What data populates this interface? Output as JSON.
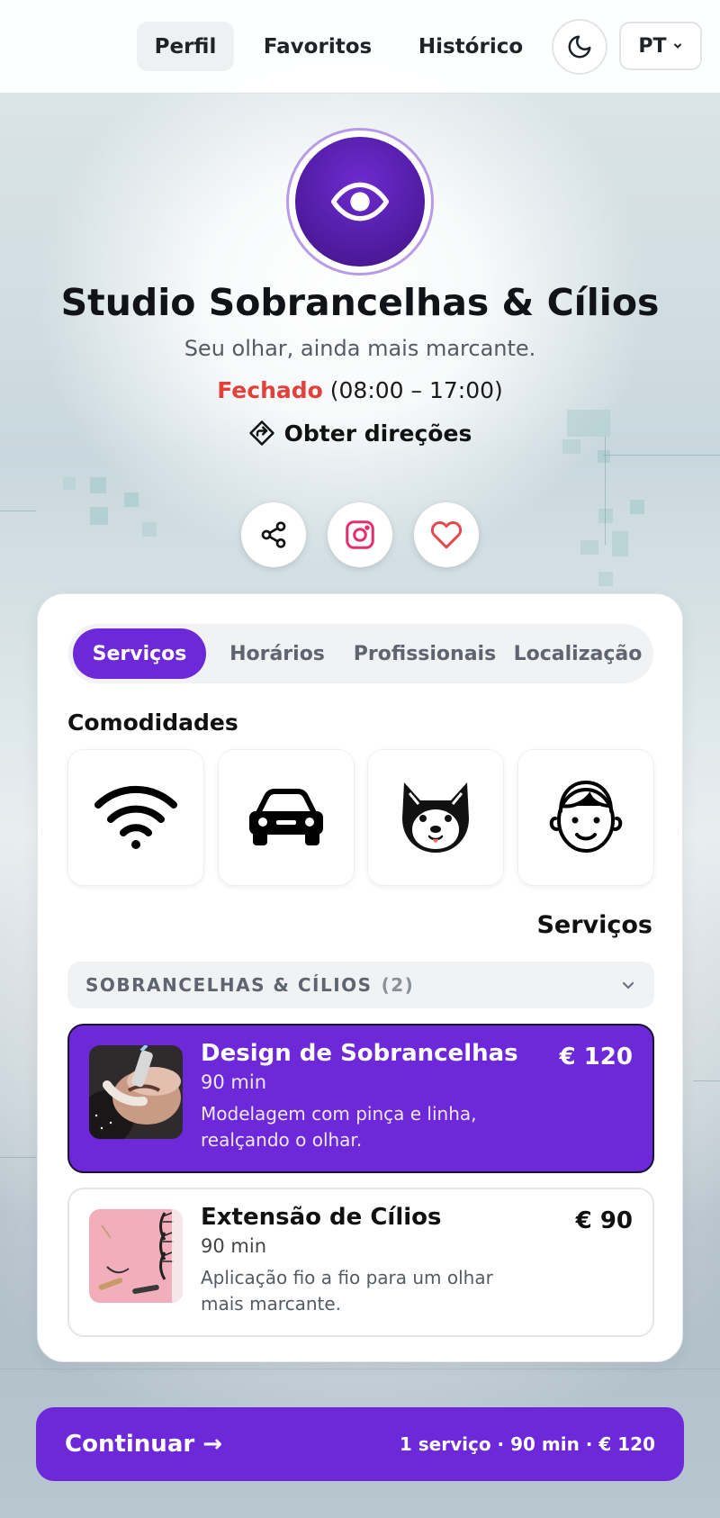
{
  "nav": {
    "items": [
      {
        "label": "Perfil",
        "active": true
      },
      {
        "label": "Favoritos",
        "active": false
      },
      {
        "label": "Histórico",
        "active": false
      }
    ],
    "theme_icon": "moon-icon",
    "language": "PT"
  },
  "business": {
    "logo_icon": "eye-icon",
    "name": "Studio Sobrancelhas & Cílios",
    "tagline": "Seu olhar, ainda mais marcante.",
    "status": "Fechado",
    "hours": "(08:00 – 17:00)",
    "directions_label": "Obter direções"
  },
  "actions": [
    {
      "icon": "share-icon"
    },
    {
      "icon": "instagram-icon"
    },
    {
      "icon": "heart-icon"
    }
  ],
  "tabs": [
    {
      "label": "Serviços",
      "active": true
    },
    {
      "label": "Horários",
      "active": false
    },
    {
      "label": "Profissionais",
      "active": false
    },
    {
      "label": "Localização",
      "active": false
    }
  ],
  "amenities": {
    "title": "Comodidades",
    "items": [
      {
        "icon": "wifi-icon"
      },
      {
        "icon": "car-icon"
      },
      {
        "icon": "dog-icon"
      },
      {
        "icon": "child-icon"
      }
    ]
  },
  "services": {
    "heading": "Serviços",
    "category": {
      "name": "SOBRANCELHAS & CÍLIOS",
      "count": "(2)",
      "expanded": true
    },
    "items": [
      {
        "name": "Design de Sobrancelhas",
        "duration": "90 min",
        "description": "Modelagem com pinça e linha, realçando o olhar.",
        "price": "€ 120",
        "selected": true
      },
      {
        "name": "Extensão de Cílios",
        "duration": "90 min",
        "description": "Aplicação fio a fio para um olhar mais marcante.",
        "price": "€ 90",
        "selected": false
      }
    ]
  },
  "cta": {
    "label": "Continuar →",
    "summary": "1 serviço · 90 min · € 120"
  },
  "colors": {
    "accent": "#6d28d9",
    "closed": "#e2403a",
    "instagram": "#e1306c",
    "heart": "#e5484d"
  }
}
